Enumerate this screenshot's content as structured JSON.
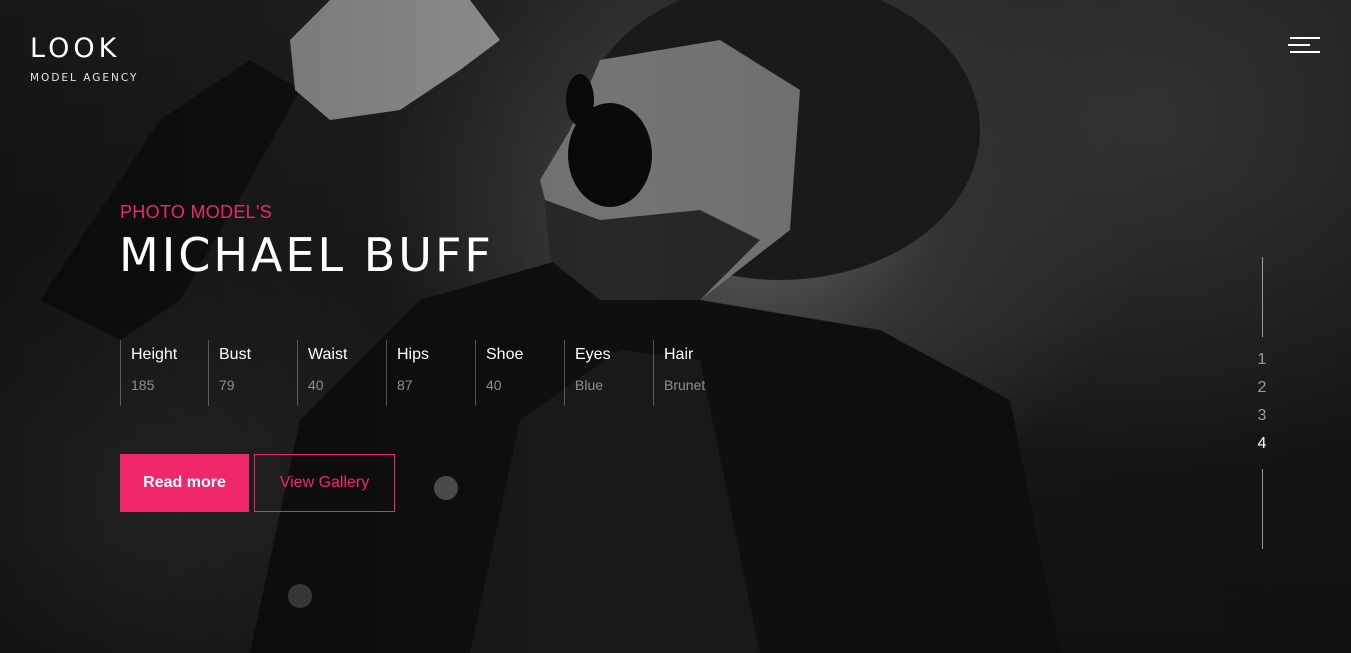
{
  "logo": {
    "title": "LOOK",
    "subtitle": "MODEL AGENCY"
  },
  "menu": {
    "icon": "hamburger-menu-icon"
  },
  "hero": {
    "eyebrow": "PHOTO MODEL'S",
    "name": "MICHAEL BUFF",
    "stats": [
      {
        "label": "Height",
        "value": "185"
      },
      {
        "label": "Bust",
        "value": "79"
      },
      {
        "label": "Waist",
        "value": "40"
      },
      {
        "label": "Hips",
        "value": "87"
      },
      {
        "label": "Shoe",
        "value": "40"
      },
      {
        "label": "Eyes",
        "value": "Blue"
      },
      {
        "label": "Hair",
        "value": "Brunet"
      }
    ],
    "primary_button": "Read more",
    "secondary_button": "View Gallery"
  },
  "pager": {
    "items": [
      "1",
      "2",
      "3",
      "4"
    ],
    "active": "4"
  },
  "colors": {
    "accent": "#f0286b",
    "text": "#ffffff",
    "muted": "#8f8f8f"
  }
}
